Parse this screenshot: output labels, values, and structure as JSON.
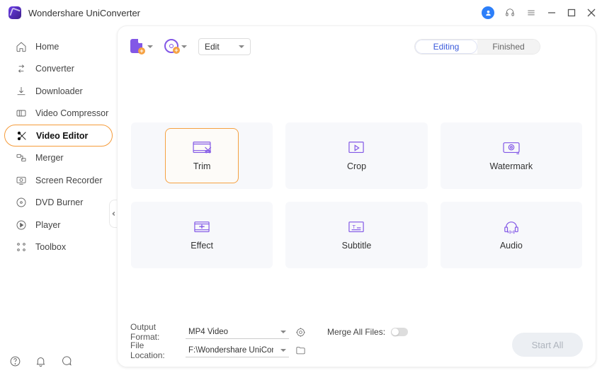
{
  "app": {
    "title": "Wondershare UniConverter"
  },
  "sidebar": {
    "items": [
      {
        "label": "Home"
      },
      {
        "label": "Converter"
      },
      {
        "label": "Downloader"
      },
      {
        "label": "Video Compressor"
      },
      {
        "label": "Video Editor"
      },
      {
        "label": "Merger"
      },
      {
        "label": "Screen Recorder"
      },
      {
        "label": "DVD Burner"
      },
      {
        "label": "Player"
      },
      {
        "label": "Toolbox"
      }
    ],
    "active_index": 4
  },
  "toolbar": {
    "mode_label": "Edit",
    "tabs": {
      "editing": "Editing",
      "finished": "Finished",
      "active": "editing"
    }
  },
  "tiles": [
    {
      "key": "trim",
      "label": "Trim",
      "selected": true
    },
    {
      "key": "crop",
      "label": "Crop",
      "selected": false
    },
    {
      "key": "watermark",
      "label": "Watermark",
      "selected": false
    },
    {
      "key": "effect",
      "label": "Effect",
      "selected": false
    },
    {
      "key": "subtitle",
      "label": "Subtitle",
      "selected": false
    },
    {
      "key": "audio",
      "label": "Audio",
      "selected": false
    }
  ],
  "bottom": {
    "output_format_label": "Output Format:",
    "output_format_value": "MP4 Video",
    "file_location_label": "File Location:",
    "file_location_value": "F:\\Wondershare UniConverter",
    "merge_label": "Merge All Files:",
    "merge_on": false,
    "start_label": "Start All"
  }
}
